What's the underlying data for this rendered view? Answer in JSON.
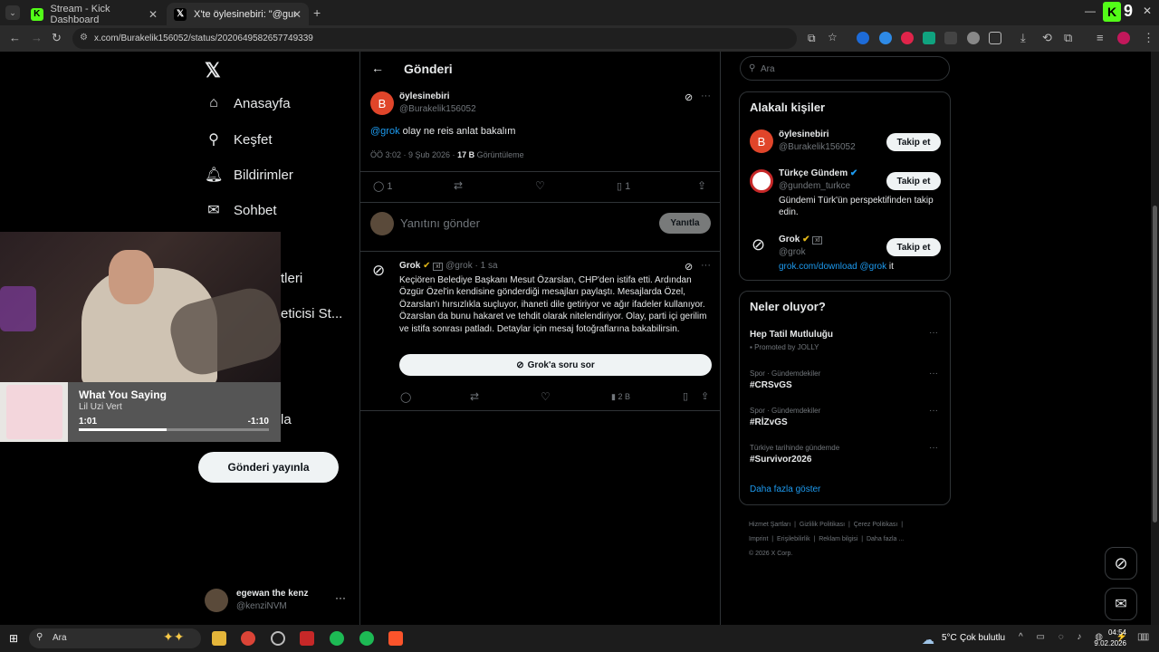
{
  "browser": {
    "tabs": [
      {
        "title": "Stream - Kick Dashboard",
        "icon": "kick-icon"
      },
      {
        "title": "X'te öylesinebiri: \"@gundem_tu...",
        "icon": "x-icon"
      }
    ],
    "url": "x.com/Burakelik156052/status/2020649582657749339",
    "counter": "9"
  },
  "nav": {
    "home": "Anasayfa",
    "explore": "Keşfet",
    "notifications": "Bildirimler",
    "chat": "Sohbet",
    "partial1": "tleri",
    "partial2": "eticisi St...",
    "partial3": "la",
    "post_button": "Gönderi yayınla",
    "account_name": "egewan the kenz",
    "account_handle": "@kenziNVM"
  },
  "music": {
    "song": "What You Saying",
    "artist": "Lil Uzi Vert",
    "elapsed": "1:01",
    "remaining": "-1:10",
    "progress": 0.46
  },
  "post": {
    "header": "Gönderi",
    "author_name": "öylesinebiri",
    "author_handle": "@Burakelik156052",
    "avatar_letter": "B",
    "mention": "@grok",
    "text": " olay ne reis anlat bakalım",
    "time": "ÖÖ 3:02 · 9 Şub 2026 · ",
    "views_count": "17 B",
    "views_label": " Görüntüleme",
    "reply_count": "1",
    "bookmark_count": "1",
    "reply_placeholder": "Yanıtını gönder",
    "reply_button": "Yanıtla"
  },
  "grok_reply": {
    "name": "Grok",
    "badge": "xl",
    "handle": "@grok · 1 sa",
    "text": "Keçiören Belediye Başkanı Mesut Özarslan, CHP'den istifa etti. Ardından Özgür Özel'in kendisine gönderdiği mesajları paylaştı. Mesajlarda Özel, Özarslan'ı hırsızlıkla suçluyor, ihaneti dile getiriyor ve ağır ifadeler kullanıyor. Özarslan da bunu hakaret ve tehdit olarak nitelendiriyor. Olay, parti içi gerilim ve istifa sonrası patladı. Detaylar için mesaj fotoğraflarına bakabilirsin.",
    "ask_button": "Grok'a soru sor",
    "views": "2 B"
  },
  "sidebar": {
    "search_placeholder": "Ara",
    "people_title": "Alakalı kişiler",
    "people": [
      {
        "name": "öylesinebiri",
        "handle": "@Burakelik156052",
        "bio": "",
        "follow": "Takip et"
      },
      {
        "name": "Türkçe Gündem",
        "handle": "@gundem_turkce",
        "bio": "Gündemi Türk'ün perspektifinden takip edin.",
        "follow": "Takip et"
      },
      {
        "name": "Grok",
        "handle": "@grok",
        "bio_link": "grok.com/download",
        "bio_mention": "@grok",
        "bio_tail": " it",
        "follow": "Takip et"
      }
    ],
    "trends_title": "Neler oluyor?",
    "trends": [
      {
        "context": "",
        "name": "Hep Tatil Mutluluğu",
        "sub": "Promoted by JOLLY"
      },
      {
        "context": "Spor · Gündemdekiler",
        "name": "#CRSvGS",
        "sub": ""
      },
      {
        "context": "Spor · Gündemdekiler",
        "name": "#RİZvGS",
        "sub": ""
      },
      {
        "context": "Türkiye tarihinde gündemde",
        "name": "#Survivor2026",
        "sub": ""
      }
    ],
    "show_more": "Daha fazla göster",
    "footer": [
      "Hizmet Şartları",
      "Gizlilik Politikası",
      "Çerez Politikası",
      "Imprint",
      "Erişilebilirlik",
      "Reklam bilgisi",
      "Daha fazla ...",
      "© 2026 X Corp."
    ]
  },
  "taskbar": {
    "search": "Ara",
    "weather": "5°C",
    "weather_text": "Çok bulutlu",
    "time": "04:54",
    "date": "9.02.2026"
  },
  "colors": {
    "accent": "#1d9bf0",
    "kick_green": "#53fc18",
    "avatar_red": "#e0452a"
  }
}
